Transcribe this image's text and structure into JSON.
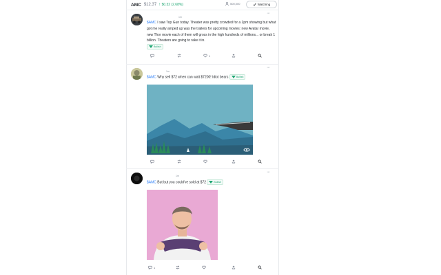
{
  "header": {
    "ticker": "AMC",
    "price": "$12.37",
    "change": "$0.32 (2.68%)",
    "watchers": "500,000",
    "watch_label": "Watching"
  },
  "posts": [
    {
      "time": "1m",
      "cashtag": "$AMC",
      "text": " I saw Top Gun today. Theater was pretty crowded for a 2pm showing but what got me really amped up was the trailers for upcoming movies: new Avatar movie, new Thor movie each of them will gross in the high hundreds of millions... or break 1 billion. Theaters are going to rake it in.",
      "sentiment": "Bullish",
      "comments": "",
      "likes": "1"
    },
    {
      "time": "1m",
      "cashtag": "$AMC",
      "text": " Why sell $72 when can wait $7200! Idiot bears",
      "sentiment": "Bullish",
      "comments": "",
      "likes": ""
    },
    {
      "time": "1m",
      "cashtag": "$AMC",
      "text": " But but you could've sold at $72",
      "sentiment": "Bullish",
      "comments": "1",
      "likes": ""
    }
  ],
  "colors": {
    "accent": "#2d7ff9",
    "bullish": "#1ea672",
    "sky": "#6fb2c3",
    "gif_bg": "#e9a9d4"
  },
  "icons": [
    "user-icon",
    "check-icon",
    "comment-icon",
    "reshare-icon",
    "heart-icon",
    "share-icon",
    "search-icon",
    "more-icon"
  ]
}
